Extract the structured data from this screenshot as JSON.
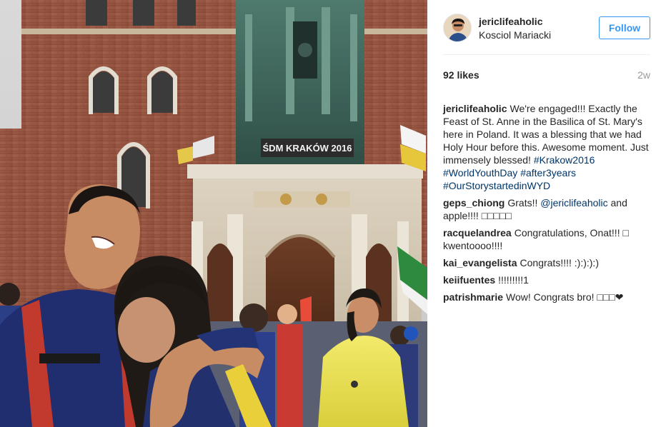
{
  "post": {
    "username": "jericlifeaholic",
    "location": "Kosciol Mariacki",
    "follow_label": "Follow",
    "likes": "92 likes",
    "age": "2w",
    "photo_sign_text": "ŚDM KRAKÓW 2016"
  },
  "caption": {
    "username": "jericlifeaholic",
    "text": "We're engaged!!! Exactly the Feast of St. Anne in the Basilica of St. Mary's here in Poland. It was a blessing that we had Holy Hour before this. Awesome moment. Just immensely blessed!",
    "tags": [
      "#Krakow2016",
      "#WorldYouthDay",
      "#after3years",
      "#OurStorystartedinWYD"
    ]
  },
  "comments": [
    {
      "username": "geps_chiong",
      "text_before": "Grats!! ",
      "mention": "@jericlifeaholic",
      "text_after": " and apple!!!! □□□□□"
    },
    {
      "username": "racquelandrea",
      "text_before": "Congratulations, Onat!!! □ kwentoooo!!!!",
      "mention": "",
      "text_after": ""
    },
    {
      "username": "kai_evangelista",
      "text_before": "Congrats!!!! :):):):)",
      "mention": "",
      "text_after": ""
    },
    {
      "username": "keiifuentes",
      "text_before": "!!!!!!!!!1",
      "mention": "",
      "text_after": ""
    },
    {
      "username": "patrishmarie",
      "text_before": "Wow! Congrats bro! □□□❤",
      "mention": "",
      "text_after": ""
    }
  ],
  "colors": {
    "link": "#003569",
    "follow": "#3897f0",
    "muted": "#999999",
    "text": "#262626"
  },
  "icons": {
    "avatar": "user-avatar-photo"
  }
}
